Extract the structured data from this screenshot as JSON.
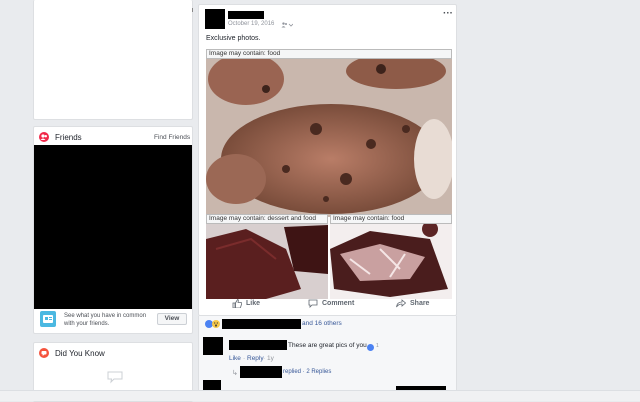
{
  "sidebar": {
    "friends": {
      "title": "Friends",
      "find_friends": "Find Friends",
      "promo_text": "See what you have in common with your friends.",
      "view_label": "View",
      "accent_color": "#f02849"
    },
    "did_you_know": {
      "title": "Did You Know",
      "accent_color": "#f5533d"
    }
  },
  "post": {
    "timestamp": "October 19, 2016",
    "privacy_icon": "friends-icon",
    "more_label": "···",
    "text": "Exclusive photos.",
    "photos": [
      {
        "alt": "Image may contain: food"
      },
      {
        "alt": "Image may contain: dessert and food"
      },
      {
        "alt": "Image may contain: food"
      }
    ],
    "actions": {
      "like": "Like",
      "comment": "Comment",
      "share": "Share"
    },
    "reactions": {
      "others_text": "and 16 others"
    }
  },
  "comments": [
    {
      "text": "These are great pics of you",
      "like": "Like",
      "reply": "Reply",
      "age": "1y",
      "replies_text": "replied · 2 Replies"
    }
  ]
}
